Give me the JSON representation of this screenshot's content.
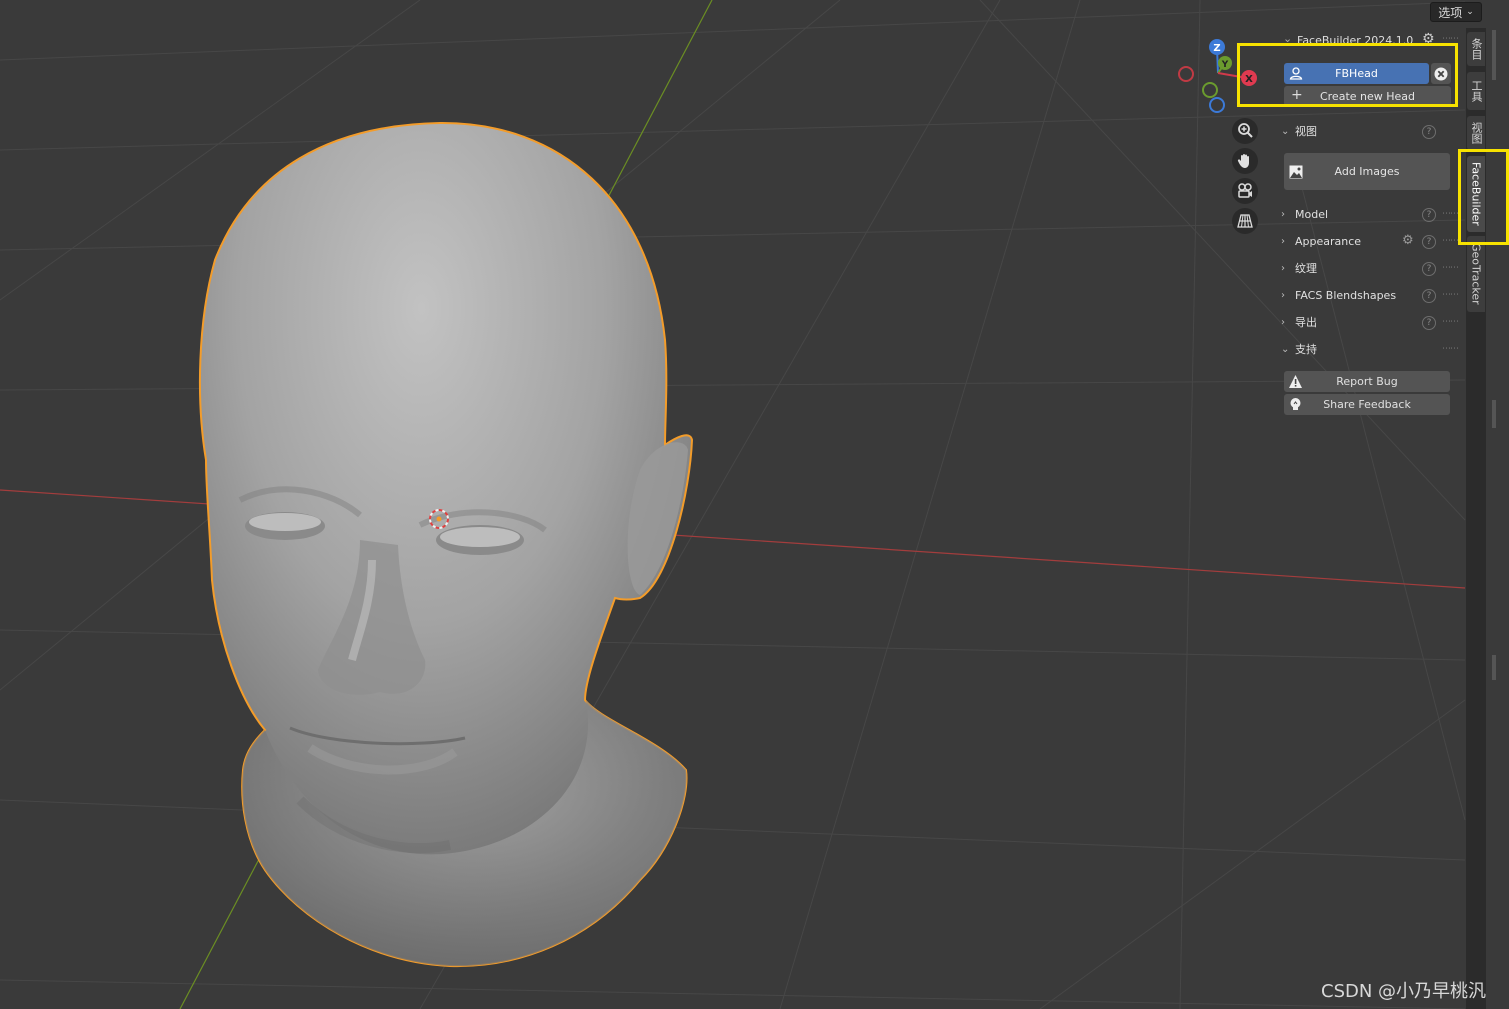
{
  "header": {
    "options_label": "选项"
  },
  "gizmo": {
    "z": "Z",
    "y": "Y",
    "x": "X"
  },
  "panel": {
    "addon_title": "FaceBuilder 2024.1.0",
    "head_name": "FBHead",
    "create_new_head": "Create new Head",
    "sections": {
      "view": "视图",
      "model": "Model",
      "appearance": "Appearance",
      "texture": "纹理",
      "facs": "FACS Blendshapes",
      "export": "导出",
      "support": "支持"
    },
    "add_images": "Add Images",
    "report_bug": "Report Bug",
    "share_feedback": "Share Feedback",
    "help_glyph": "?"
  },
  "sidebar_tabs": [
    "条目",
    "工具",
    "视图",
    "FaceBuilder",
    "GeoTracker"
  ],
  "watermark": "CSDN @小乃早桃汎",
  "colors": {
    "viewport_bg": "#3a3a3a",
    "grid": "#4a4a4a",
    "x_axis": "#a33d3d",
    "y_axis": "#6b8e23",
    "selection_outline": "#f39c2a",
    "head_select": "#4772b3",
    "highlight": "#f7e200"
  }
}
